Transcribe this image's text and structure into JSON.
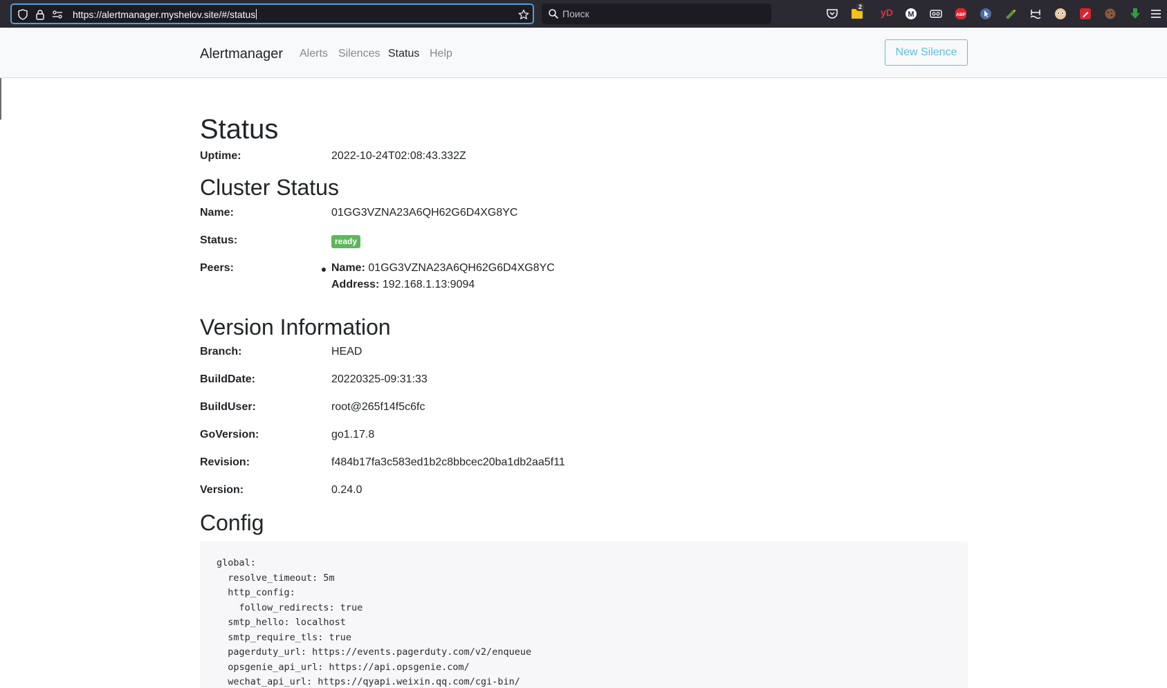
{
  "browser": {
    "url": "https://alertmanager.myshelov.site/#/status",
    "search_placeholder": "Поиск",
    "extension_badge": "2",
    "extension_text": "yD",
    "extensions": [
      "pocket-icon",
      "extension-folder-icon",
      "yandex-icon",
      "medium-icon",
      "glasses-icon",
      "adblock-icon",
      "cursor-icon",
      "pencil-icon",
      "water-icon",
      "eyes-icon",
      "pen-icon",
      "cookie-icon",
      "download-icon",
      "menu-icon"
    ]
  },
  "navbar": {
    "brand": "Alertmanager",
    "links": [
      "Alerts",
      "Silences",
      "Status",
      "Help"
    ],
    "active": "Status",
    "new_silence": "New Silence"
  },
  "status": {
    "title": "Status",
    "uptime_label": "Uptime:",
    "uptime": "2022-10-24T02:08:43.332Z"
  },
  "cluster": {
    "title": "Cluster Status",
    "name_label": "Name:",
    "name": "01GG3VZNA23A6QH62G6D4XG8YC",
    "status_label": "Status:",
    "status": "ready",
    "peers_label": "Peers:",
    "peers": [
      {
        "name_label": "Name:",
        "name": "01GG3VZNA23A6QH62G6D4XG8YC",
        "address_label": "Address:",
        "address": "192.168.1.13:9094"
      }
    ]
  },
  "version": {
    "title": "Version Information",
    "rows": [
      {
        "label": "Branch:",
        "value": "HEAD"
      },
      {
        "label": "BuildDate:",
        "value": "20220325-09:31:33"
      },
      {
        "label": "BuildUser:",
        "value": "root@265f14f5c6fc"
      },
      {
        "label": "GoVersion:",
        "value": "go1.17.8"
      },
      {
        "label": "Revision:",
        "value": "f484b17fa3c583ed1b2c8bbcec20ba1db2aa5f11"
      },
      {
        "label": "Version:",
        "value": "0.24.0"
      }
    ]
  },
  "config": {
    "title": "Config",
    "text": "global:\n  resolve_timeout: 5m\n  http_config:\n    follow_redirects: true\n  smtp_hello: localhost\n  smtp_require_tls: true\n  pagerduty_url: https://events.pagerduty.com/v2/enqueue\n  opsgenie_api_url: https://api.opsgenie.com/\n  wechat_api_url: https://qyapi.weixin.qq.com/cgi-bin/"
  },
  "colors": {
    "accent": "#5bc0de",
    "ready": "#5cb85c",
    "browser_bg": "#2b2a33",
    "navbar_bg": "#f8f9fa",
    "config_bg": "#f7f7f9"
  }
}
